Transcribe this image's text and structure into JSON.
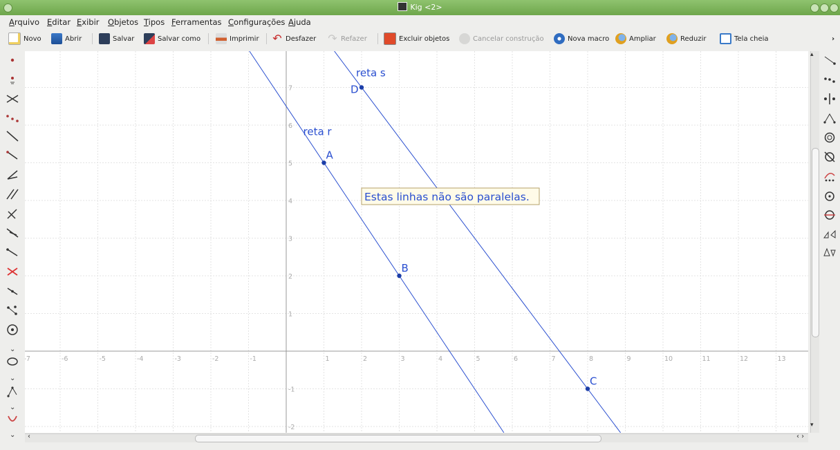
{
  "window": {
    "title": "Kig <2>"
  },
  "menu": [
    "Arquivo",
    "Editar",
    "Exibir",
    "Objetos",
    "Tipos",
    "Ferramentas",
    "Configurações",
    "Ajuda"
  ],
  "toolbar": {
    "novo": "Novo",
    "abrir": "Abrir",
    "salvar": "Salvar",
    "salvar_como": "Salvar como",
    "imprimir": "Imprimir",
    "desfazer": "Desfazer",
    "refazer": "Refazer",
    "excluir": "Excluir objetos",
    "cancelar": "Cancelar construção",
    "nova_macro": "Nova macro",
    "ampliar": "Ampliar",
    "reduzir": "Reduzir",
    "tela_cheia": "Tela cheia"
  },
  "colors": {
    "line": "#2a4fd0",
    "point": "#1c3ea8",
    "label": "#2a4fd0",
    "grid": "#e3e3e3",
    "axis": "#999999",
    "titlebar": "#7ab257"
  },
  "axes": {
    "x_ticks": [
      "-7",
      "-6",
      "-5",
      "-4",
      "-3",
      "-2",
      "-1",
      "1",
      "2",
      "3",
      "4",
      "5",
      "6",
      "7",
      "8",
      "9",
      "10",
      "11",
      "12",
      "13"
    ],
    "y_ticks": [
      "7",
      "6",
      "5",
      "4",
      "3",
      "2",
      "1",
      "-1",
      "-2"
    ]
  },
  "points": [
    {
      "name": "A",
      "x": 1,
      "y": 5
    },
    {
      "name": "B",
      "x": 3,
      "y": 2
    },
    {
      "name": "C",
      "x": 8,
      "y": -1
    },
    {
      "name": "D",
      "x": 2,
      "y": 7
    }
  ],
  "lines": [
    {
      "name": "reta r",
      "through": [
        "A",
        "B"
      ]
    },
    {
      "name": "reta s",
      "through": [
        "D",
        "C"
      ]
    }
  ],
  "message": "Estas linhas não são paralelas."
}
